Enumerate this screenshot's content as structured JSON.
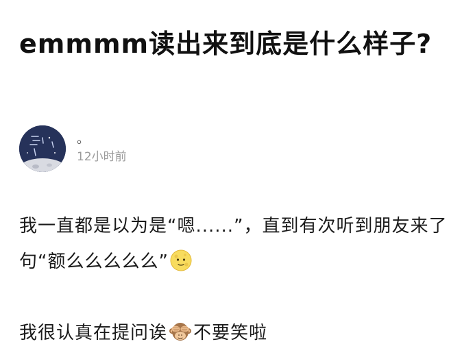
{
  "post": {
    "title": "emmmm读出来到底是什么样子?",
    "author": {
      "name": "。",
      "time": "12小时前"
    },
    "body": {
      "paragraph1_text": "我一直都是以为是“嗯......”，直到有次听到朋友来了句“额么么么么么”",
      "paragraph1_emoji": "full-moon-face-icon",
      "paragraph2_before": "我很认真在提问诶",
      "paragraph2_emoji": "see-no-evil-monkey-icon",
      "paragraph2_after": "不要笑啦"
    }
  },
  "colors": {
    "title": "#111111",
    "body_text": "#1a1a1a",
    "meta_text": "#9a9a9a",
    "background": "#ffffff",
    "avatar_bg": "#243052"
  }
}
